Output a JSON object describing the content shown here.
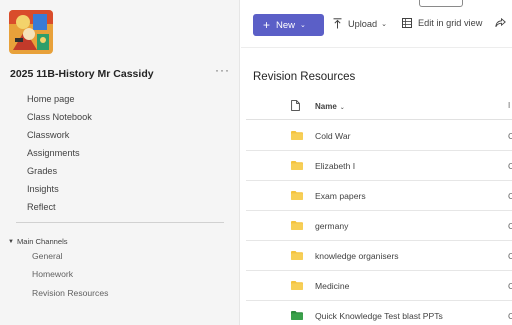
{
  "sidebar": {
    "team_name": "2025 11B-History Mr Cassidy",
    "more_label": "···",
    "items": [
      {
        "label": "Home page"
      },
      {
        "label": "Class Notebook"
      },
      {
        "label": "Classwork"
      },
      {
        "label": "Assignments"
      },
      {
        "label": "Grades"
      },
      {
        "label": "Insights"
      },
      {
        "label": "Reflect"
      }
    ],
    "section_label": "Main Channels",
    "channels": [
      {
        "label": "General"
      },
      {
        "label": "Homework"
      },
      {
        "label": "Revision Resources"
      }
    ]
  },
  "toolbar": {
    "new_label": "New",
    "upload_label": "Upload",
    "grid_label": "Edit in grid view"
  },
  "library": {
    "title": "Revision Resources",
    "column_name": "Name",
    "column_trunc": "I",
    "rows": [
      {
        "name": "Cold War",
        "type": "folder",
        "trunc": "C"
      },
      {
        "name": "Elizabeth I",
        "type": "folder",
        "trunc": "C"
      },
      {
        "name": "Exam papers",
        "type": "folder",
        "trunc": "C"
      },
      {
        "name": "germany",
        "type": "folder",
        "trunc": "C"
      },
      {
        "name": "knowledge organisers",
        "type": "folder",
        "trunc": "C"
      },
      {
        "name": "Medicine",
        "type": "folder",
        "trunc": "C"
      },
      {
        "name": "Quick Knowledge Test blast PPTs",
        "type": "folder-green",
        "trunc": "C"
      }
    ]
  },
  "colors": {
    "accent": "#5b5fc7",
    "folder": "#f4c33f",
    "folder_green": "#2e8b3d",
    "sidebar_bg": "#f5f5f5"
  }
}
